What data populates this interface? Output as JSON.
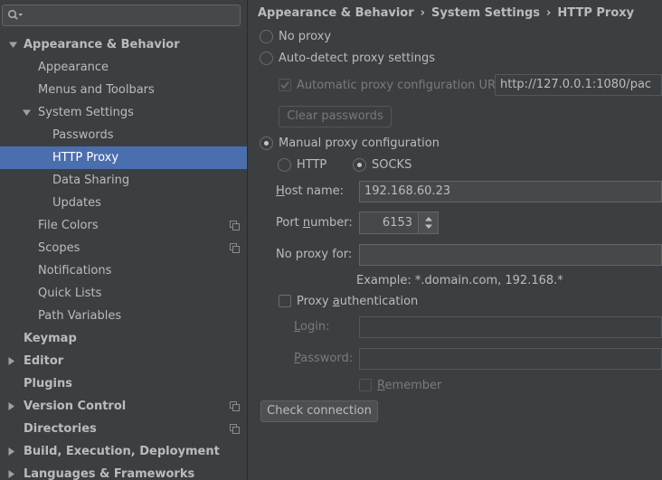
{
  "search": {
    "placeholder": ""
  },
  "sidebar": {
    "items": [
      {
        "label": "Appearance & Behavior",
        "name": "sidebar-item-appearance-behavior"
      },
      {
        "label": "Appearance",
        "name": "sidebar-item-appearance"
      },
      {
        "label": "Menus and Toolbars",
        "name": "sidebar-item-menus-toolbars"
      },
      {
        "label": "System Settings",
        "name": "sidebar-item-system-settings"
      },
      {
        "label": "Passwords",
        "name": "sidebar-item-passwords"
      },
      {
        "label": "HTTP Proxy",
        "name": "sidebar-item-http-proxy"
      },
      {
        "label": "Data Sharing",
        "name": "sidebar-item-data-sharing"
      },
      {
        "label": "Updates",
        "name": "sidebar-item-updates"
      },
      {
        "label": "File Colors",
        "name": "sidebar-item-file-colors"
      },
      {
        "label": "Scopes",
        "name": "sidebar-item-scopes"
      },
      {
        "label": "Notifications",
        "name": "sidebar-item-notifications"
      },
      {
        "label": "Quick Lists",
        "name": "sidebar-item-quick-lists"
      },
      {
        "label": "Path Variables",
        "name": "sidebar-item-path-variables"
      },
      {
        "label": "Keymap",
        "name": "sidebar-item-keymap"
      },
      {
        "label": "Editor",
        "name": "sidebar-item-editor"
      },
      {
        "label": "Plugins",
        "name": "sidebar-item-plugins"
      },
      {
        "label": "Version Control",
        "name": "sidebar-item-version-control"
      },
      {
        "label": "Directories",
        "name": "sidebar-item-directories"
      },
      {
        "label": "Build, Execution, Deployment",
        "name": "sidebar-item-build"
      },
      {
        "label": "Languages & Frameworks",
        "name": "sidebar-item-languages"
      }
    ],
    "selected": "HTTP Proxy"
  },
  "breadcrumb": {
    "items": [
      "Appearance & Behavior",
      "System Settings",
      "HTTP Proxy"
    ],
    "separator": "›"
  },
  "proxy": {
    "no_proxy_label": "No proxy",
    "auto_detect_label": "Auto-detect proxy settings",
    "auto_config_url_label": "Automatic proxy configuration URL:",
    "auto_config_url_value": "http://127.0.0.1:1080/pac",
    "clear_passwords_label": "Clear passwords",
    "manual_label": "Manual proxy configuration",
    "http_label": "HTTP",
    "socks_label": "SOCKS",
    "selected_mode": "Manual proxy configuration",
    "selected_type": "SOCKS",
    "host_name_label_pre": "",
    "host_name_label_u": "H",
    "host_name_label_post": "ost name:",
    "host_name_value": "192.168.60.23",
    "port_label_pre": "Port ",
    "port_label_u": "n",
    "port_label_post": "umber:",
    "port_value": "6153",
    "no_proxy_for_label": "No proxy for:",
    "no_proxy_for_value": "",
    "example_text": "Example: *.domain.com, 192.168.*",
    "proxy_auth_label_pre": "Proxy ",
    "proxy_auth_label_u": "a",
    "proxy_auth_label_post": "uthentication",
    "login_label_pre": "",
    "login_label_u": "L",
    "login_label_post": "ogin:",
    "login_value": "",
    "password_label_pre": "",
    "password_label_u": "P",
    "password_label_post": "assword:",
    "password_value": "",
    "remember_label_pre": "",
    "remember_label_u": "R",
    "remember_label_post": "emember",
    "check_connection_label": "Check connection"
  },
  "colors": {
    "background": "#3c3f41",
    "selection": "#4b6eaf",
    "text": "#bbbbbb"
  }
}
